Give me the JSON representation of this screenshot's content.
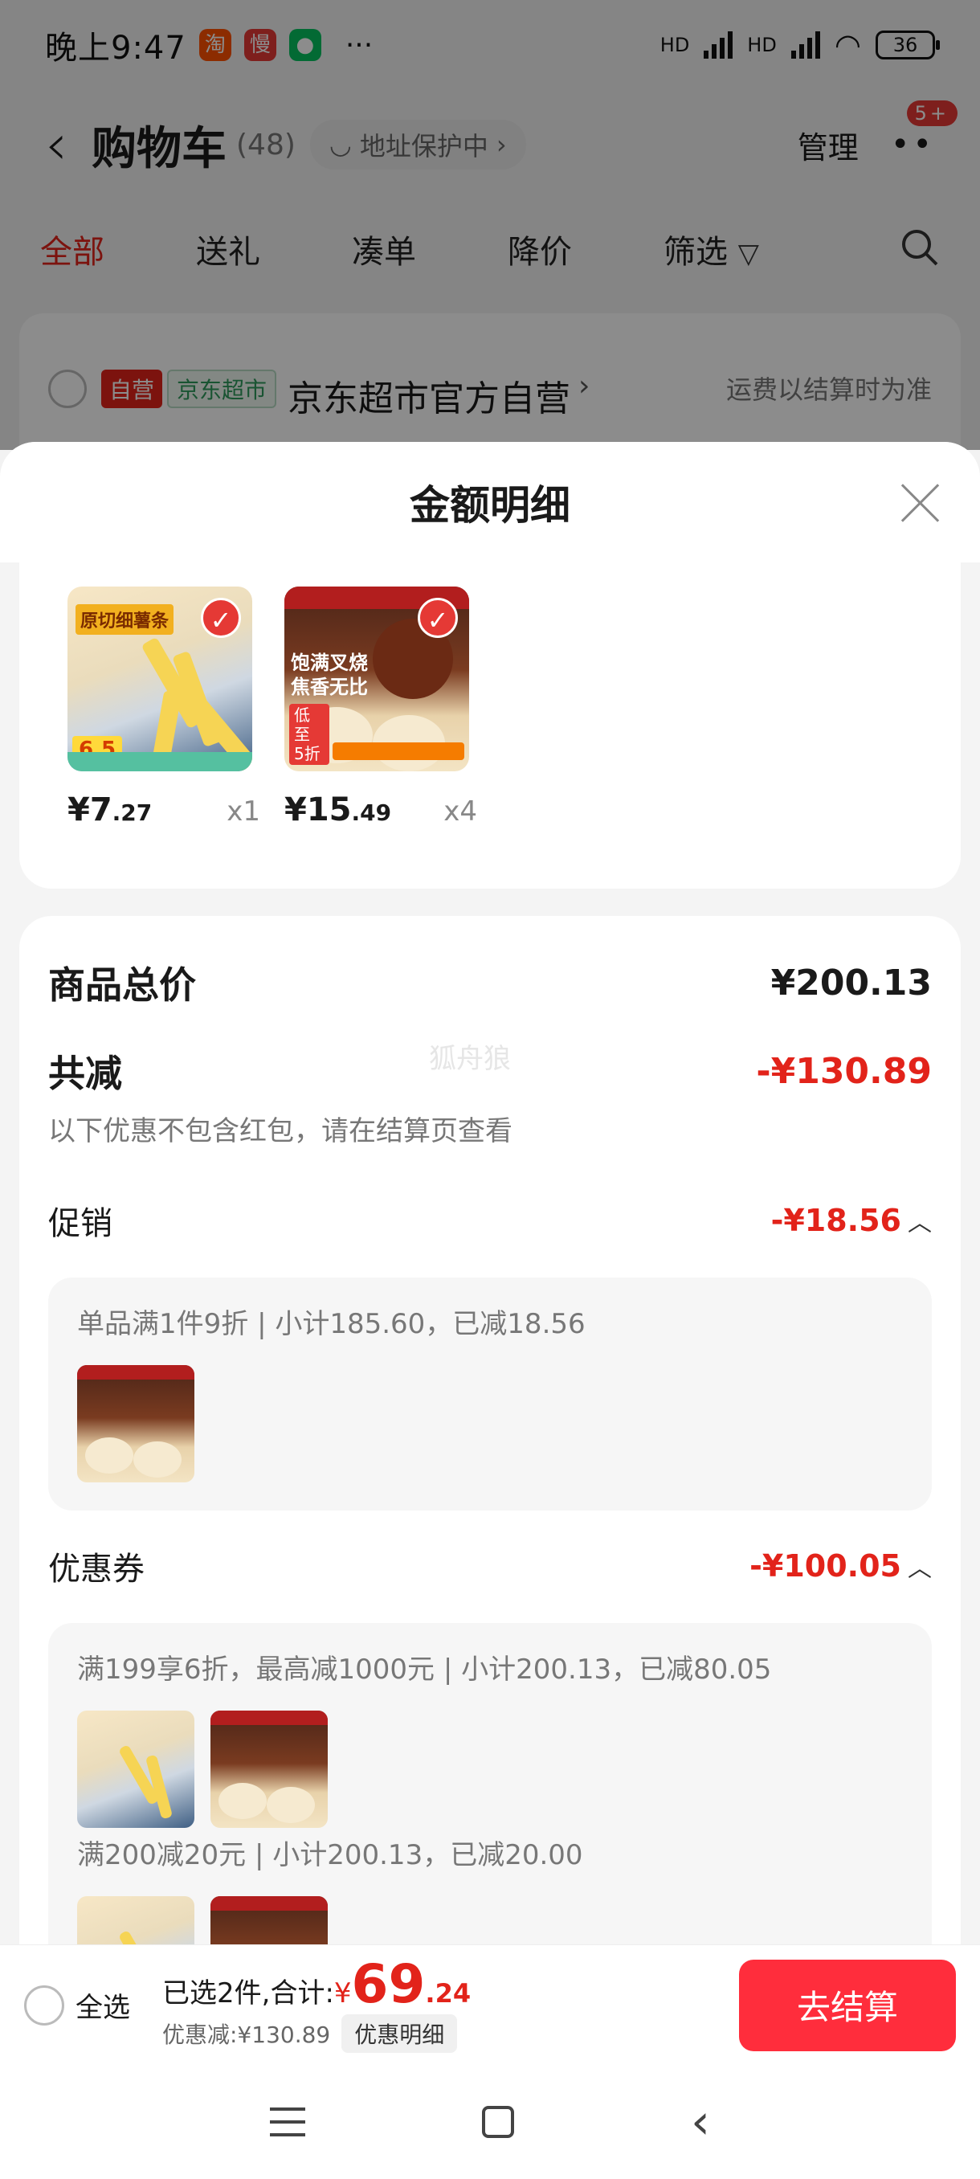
{
  "status_bar": {
    "time": "晚上9:47",
    "app_icons": [
      {
        "name": "taobao-icon",
        "glyph": "淘",
        "color": "#ff5000"
      },
      {
        "name": "slow-app-icon",
        "glyph": "慢",
        "color": "#e53935"
      },
      {
        "name": "wechat-icon",
        "glyph": "●",
        "color": "#07c160"
      }
    ],
    "more": "···",
    "network1": "HD",
    "network2": "HD",
    "battery": "36"
  },
  "nav": {
    "back_icon": "‹",
    "title": "购物车",
    "count": "(48)",
    "address": "地址保护中",
    "address_chevron": "›",
    "manage": "管理",
    "more_badge": "5+"
  },
  "tabs": [
    {
      "label": "全部",
      "active": true
    },
    {
      "label": "送礼"
    },
    {
      "label": "凑单"
    },
    {
      "label": "降价"
    },
    {
      "label": "筛选"
    }
  ],
  "store": {
    "tag_self": "自营",
    "tag_market": "京东超市",
    "name": "京东超市官方自营",
    "name_chevron": "›",
    "shipping_note": "运费以结算时为准"
  },
  "sheet": {
    "title": "金额明细",
    "products": [
      {
        "price_int": "¥7",
        "price_dec": ".27",
        "qty": "x1",
        "img": "fries",
        "img_head": "原切细薯条",
        "img_price": "6.5"
      },
      {
        "price_int": "¥15",
        "price_dec": ".49",
        "qty": "x4",
        "img": "bun",
        "img_head": "饱满叉烧 焦香无比",
        "img_low": "低至 5折"
      }
    ],
    "total_label": "商品总价",
    "total_value": "¥200.13",
    "watermark": "狐舟狼",
    "reduce_label": "共减",
    "reduce_value": "-¥130.89",
    "reduce_note": "以下优惠不包含红包，请在结算页查看",
    "promo_label": "促销",
    "promo_value": "-¥18.56",
    "promo_line": "单品满1件9折 | 小计185.60，已减18.56",
    "coupon_label": "优惠券",
    "coupon_value": "-¥100.05",
    "coupon_line1": "满199享6折，最高减1000元 | 小计200.13，已减80.05",
    "coupon_line2": "满200减20元 | 小计200.13，已减20.00",
    "chev_up": "︿"
  },
  "footer": {
    "select_all": "全选",
    "selected_text": "已选2件,合计:",
    "yen": "¥",
    "total_int": "69",
    "total_dec": ".24",
    "discount_text": "优惠减:¥130.89",
    "detail_chip": "优惠明细",
    "checkout": "去结算"
  },
  "colors": {
    "accent_red": "#e2231a",
    "checkout_red": "#ff2d3c"
  }
}
